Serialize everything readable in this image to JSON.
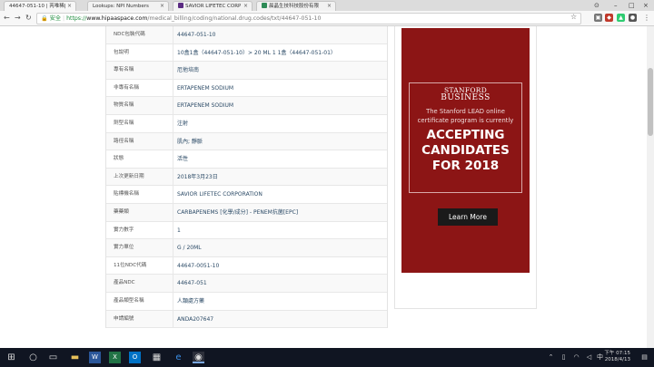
{
  "browser": {
    "tabs": [
      {
        "label": "44647-051-10 | 芮唯稀|",
        "active": true,
        "icon_color": "#c0392b"
      },
      {
        "label": "Lookups: NPI Numbers",
        "active": false,
        "icon_color": "#2c7be5"
      },
      {
        "label": "SAVIOR LIFETEC CORP",
        "active": false,
        "icon_color": "#5b2c83"
      },
      {
        "label": "晨晶生技科技股份有限",
        "active": false,
        "icon_color": "#2e8b57"
      }
    ],
    "security_label": "安全",
    "url_scheme": "https://",
    "url_domain": "www.hipaaspace.com",
    "url_path": "/medical_billing/coding/national.drug.codes/txt/44647-051-10"
  },
  "table": {
    "rows": [
      {
        "key": "NDC包裝代碼",
        "value": "44647-051-10"
      },
      {
        "key": "包說明",
        "value": "10盒1盒（44647-051-10）> 20 ML 1 1盒（44647-051-01）"
      },
      {
        "key": "專有名稱",
        "value": "厄他培南"
      },
      {
        "key": "非專有名稱",
        "value": "ERTAPENEM SODIUM"
      },
      {
        "key": "物質名稱",
        "value": "ERTAPENEM SODIUM"
      },
      {
        "key": "劑型名稱",
        "value": "注射"
      },
      {
        "key": "路徑名稱",
        "value": "肌內; 靜脈"
      },
      {
        "key": "狀態",
        "value": "活性"
      },
      {
        "key": "上次更新日期",
        "value": "2018年3月23日"
      },
      {
        "key": "貼標機名稱",
        "value": "SAVIOR LIFETEC CORPORATION"
      },
      {
        "key": "藥藥類",
        "value": "CARBAPENEMS [化學/成分] - PENEM抗菌[EPC]"
      },
      {
        "key": "實力數字",
        "value": "1"
      },
      {
        "key": "實力單位",
        "value": "G / 20ML"
      },
      {
        "key": "11位NDC代碼",
        "value": "44647-0051-10"
      },
      {
        "key": "產品NDC",
        "value": "44647-051"
      },
      {
        "key": "產品類型名稱",
        "value": "人類處方藥"
      },
      {
        "key": "申請編號",
        "value": "ANDA207647"
      }
    ]
  },
  "ad": {
    "brand_line1": "STANFORD",
    "brand_line2": "BUSINESS",
    "subtitle": "The Stanford LEAD online certificate program is currently",
    "headline": "ACCEPTING CANDIDATES FOR 2018",
    "button": "Learn More"
  },
  "taskbar": {
    "time": "下午 07:15",
    "date": "2018/4/13"
  }
}
